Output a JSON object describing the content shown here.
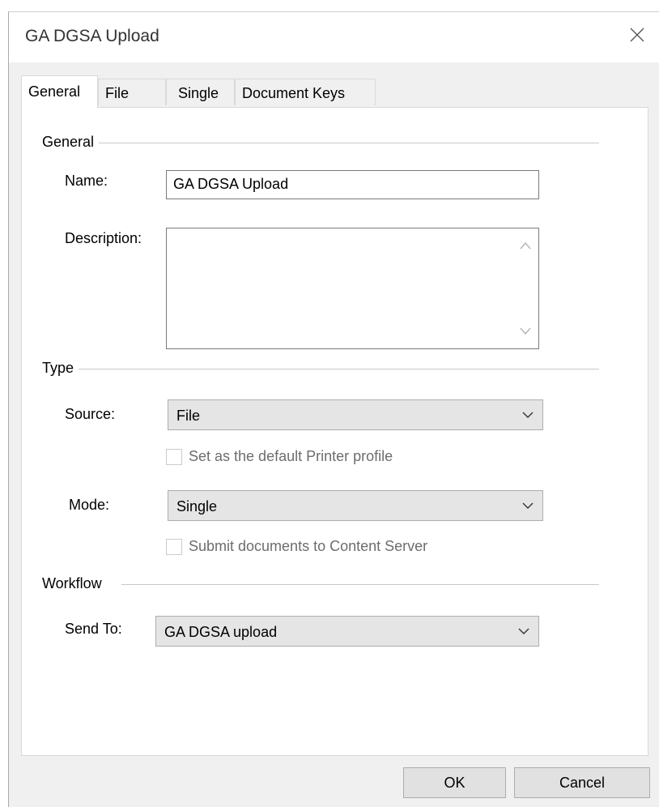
{
  "window": {
    "title": "GA DGSA Upload"
  },
  "tabs": [
    {
      "label": "General",
      "active": true
    },
    {
      "label": "File",
      "active": false
    },
    {
      "label": "Single",
      "active": false
    },
    {
      "label": "Document Keys",
      "active": false
    }
  ],
  "general_group": {
    "heading": "General",
    "name_label": "Name:",
    "name_value": "GA DGSA Upload",
    "description_label": "Description:",
    "description_value": ""
  },
  "type_group": {
    "heading": "Type",
    "source_label": "Source:",
    "source_value": "File",
    "default_printer_label": "Set as the default Printer profile",
    "default_printer_checked": false,
    "mode_label": "Mode:",
    "mode_value": "Single",
    "submit_label": "Submit documents to Content Server",
    "submit_checked": false
  },
  "workflow_group": {
    "heading": "Workflow",
    "send_to_label": "Send To:",
    "send_to_value": "GA DGSA upload"
  },
  "buttons": {
    "ok": "OK",
    "cancel": "Cancel"
  },
  "icons": {
    "close": "close-icon",
    "dropdown": "chevron-down-icon",
    "scroll_up": "chevron-up-icon",
    "scroll_down": "chevron-down-icon"
  },
  "colors": {
    "panel": "#ffffff",
    "dialog": "#f0f0f0",
    "combo": "#e5e5e5",
    "button": "#e1e1e1"
  }
}
